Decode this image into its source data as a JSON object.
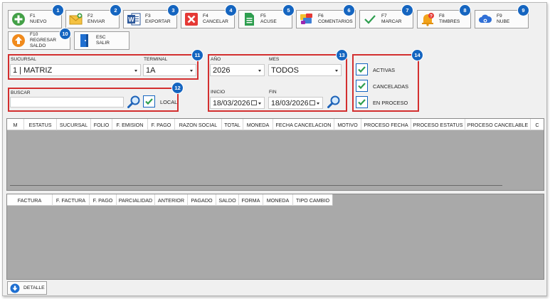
{
  "toolbar": {
    "buttons": [
      {
        "key": "F1",
        "label": "NUEVO",
        "badge": "1"
      },
      {
        "key": "F2",
        "label": "ENVIAR",
        "badge": "2"
      },
      {
        "key": "F3",
        "label": "EXPORTAR",
        "badge": "3"
      },
      {
        "key": "F4",
        "label": "CANCELAR",
        "badge": "4"
      },
      {
        "key": "F5",
        "label": "ACUSE",
        "badge": "5"
      },
      {
        "key": "F6",
        "label": "COMENTARIOS",
        "badge": "6"
      },
      {
        "key": "F7",
        "label": "MARCAR",
        "badge": "7"
      },
      {
        "key": "F8",
        "label": "TIMBRES",
        "badge": "8"
      },
      {
        "key": "F9",
        "label": "NUBE",
        "badge": "9"
      },
      {
        "key": "F10",
        "label": "REGRESAR SALDO",
        "badge": "10"
      },
      {
        "key": "ESC",
        "label": "SALIR",
        "badge": ""
      }
    ]
  },
  "filters": {
    "sucursal": {
      "label": "SUCURSAL",
      "value": "1 | MATRIZ"
    },
    "terminal": {
      "label": "TERMINAL",
      "value": "1A"
    },
    "branch_badge": "11",
    "buscar": {
      "label": "BUSCAR",
      "value": "",
      "local_label": "LOCAL",
      "badge": "12"
    },
    "anio": {
      "label": "AÑO",
      "value": "2026"
    },
    "mes": {
      "label": "MES",
      "value": "TODOS"
    },
    "inicio": {
      "label": "INICIO",
      "value": "18/03/2026"
    },
    "fin": {
      "label": "FIN",
      "value": "18/03/2026"
    },
    "date_badge": "13",
    "status": {
      "badge": "14",
      "options": [
        {
          "label": "ACTIVAS",
          "checked": true
        },
        {
          "label": "CANCELADAS",
          "checked": true
        },
        {
          "label": "EN PROCESO",
          "checked": true
        }
      ]
    }
  },
  "main_grid": {
    "columns": [
      "M",
      "ESTATUS",
      "SUCURSAL",
      "FOLIO",
      "F. EMISION",
      "F. PAGO",
      "RAZON SOCIAL",
      "TOTAL",
      "MONEDA",
      "FECHA CANCELACION",
      "MOTIVO",
      "PROCESO FECHA",
      "PROCESO ESTATUS",
      "PROCESO CANCELABLE",
      "C"
    ],
    "rows": []
  },
  "detail_grid": {
    "columns": [
      "FACTURA",
      "F. FACTURA",
      "F. PAGO",
      "PARCIALIDAD",
      "ANTERIOR",
      "PAGADO",
      "SALDO",
      "FORMA",
      "MONEDA",
      "TIPO CAMBIO"
    ],
    "rows": []
  },
  "footer": {
    "detail_label": "DETALLE"
  },
  "colors": {
    "accent": "#1565c0",
    "highlight": "#d32f2f",
    "grid_bg": "#a9a9a9"
  }
}
